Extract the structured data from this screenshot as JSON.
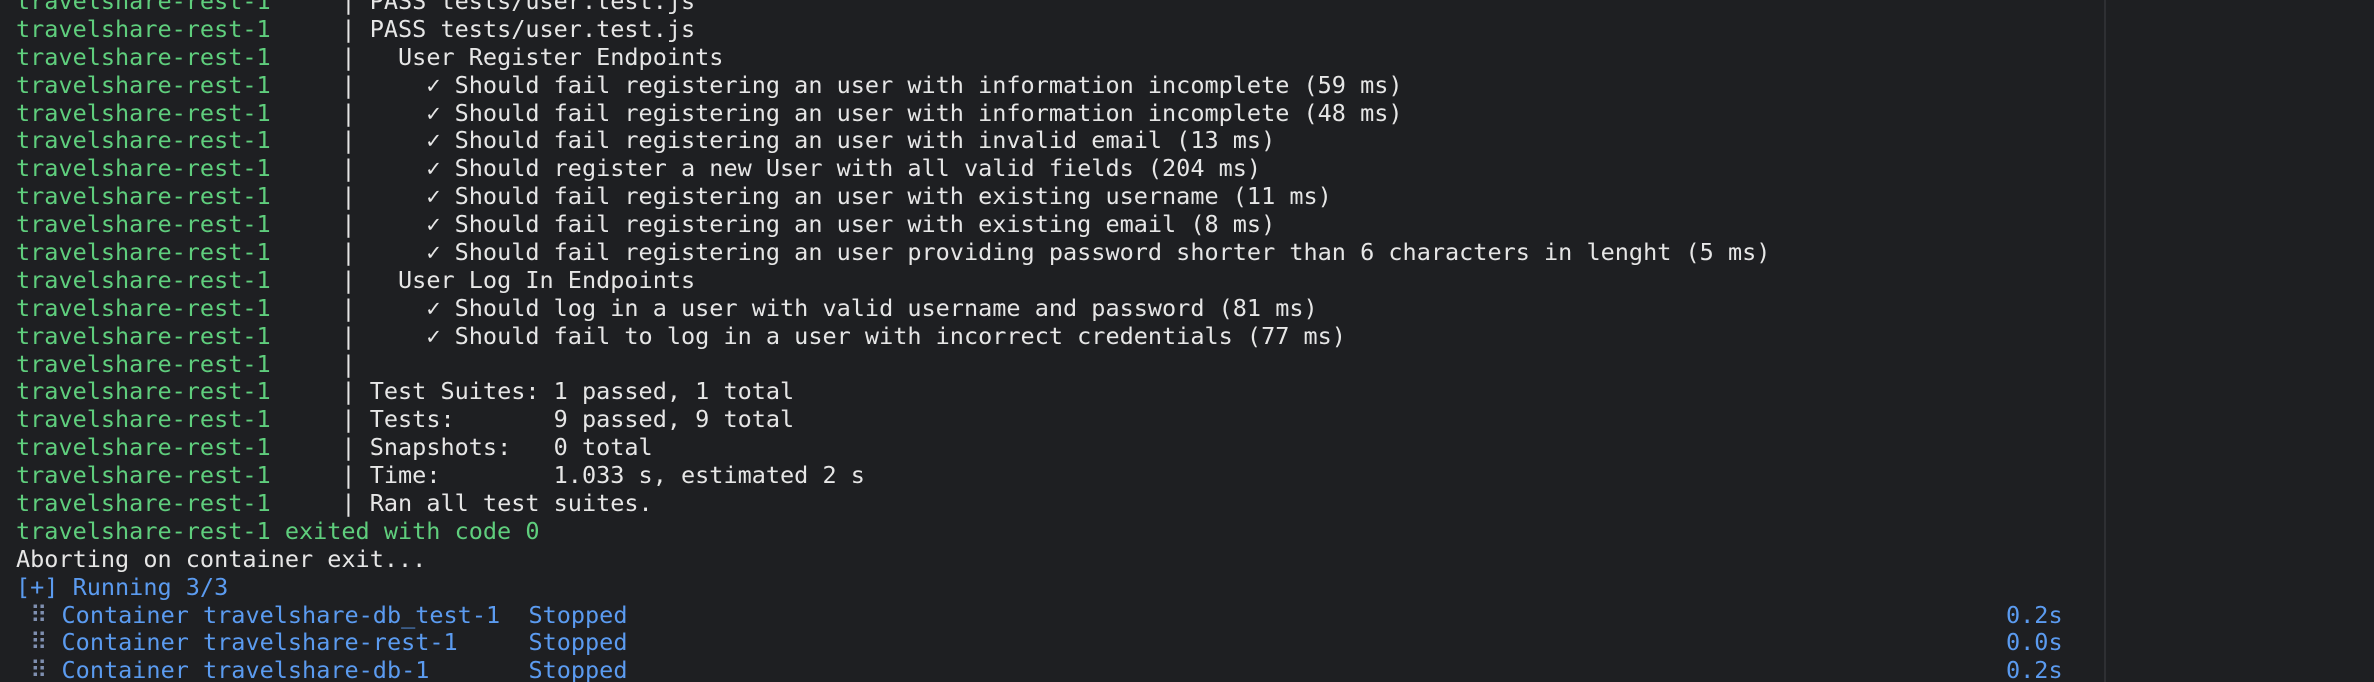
{
  "service_prefix": "travelshare-rest-1",
  "pipe": "|",
  "log_lines": [
    {
      "text": "PASS tests/user.test.js"
    },
    {
      "text": "PASS tests/user.test.js"
    },
    {
      "text": "  User Register Endpoints"
    },
    {
      "text": "    ✓ Should fail registering an user with information incomplete (59 ms)"
    },
    {
      "text": "    ✓ Should fail registering an user with information incomplete (48 ms)"
    },
    {
      "text": "    ✓ Should fail registering an user with invalid email (13 ms)"
    },
    {
      "text": "    ✓ Should register a new User with all valid fields (204 ms)"
    },
    {
      "text": "    ✓ Should fail registering an user with existing username (11 ms)"
    },
    {
      "text": "    ✓ Should fail registering an user with existing email (8 ms)"
    },
    {
      "text": "    ✓ Should fail registering an user providing password shorter than 6 characters in lenght (5 ms)"
    },
    {
      "text": "  User Log In Endpoints"
    },
    {
      "text": "    ✓ Should log in a user with valid username and password (81 ms)"
    },
    {
      "text": "    ✓ Should fail to log in a user with incorrect credentials (77 ms)"
    },
    {
      "text": ""
    },
    {
      "text": "Test Suites: 1 passed, 1 total"
    },
    {
      "text": "Tests:       9 passed, 9 total"
    },
    {
      "text": "Snapshots:   0 total"
    },
    {
      "text": "Time:        1.033 s, estimated 2 s"
    },
    {
      "text": "Ran all test suites."
    }
  ],
  "exit_line": "travelshare-rest-1 exited with code 0",
  "abort_line": "Aborting on container exit...",
  "running_line": "[+] Running 3/3",
  "containers": [
    {
      "glyph": "⠿",
      "name": "Container travelshare-db_test-1 ",
      "status": "Stopped",
      "time": "0.2s"
    },
    {
      "glyph": "⠿",
      "name": "Container travelshare-rest-1    ",
      "status": "Stopped",
      "time": "0.0s"
    },
    {
      "glyph": "⠿",
      "name": "Container travelshare-db-1      ",
      "status": "Stopped",
      "time": "0.2s"
    }
  ]
}
